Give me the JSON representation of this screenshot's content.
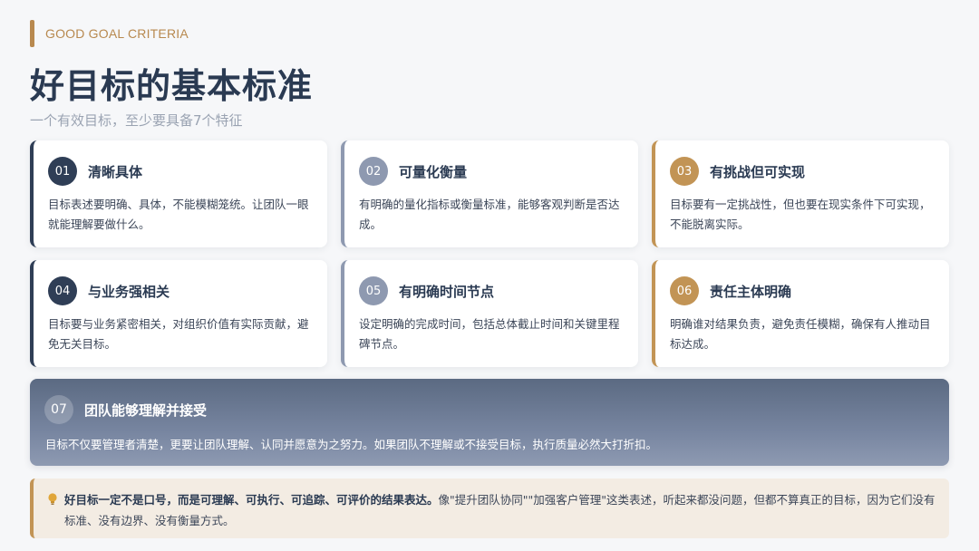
{
  "eyebrow": "GOOD GOAL CRITERIA",
  "title": "好目标的基本标准",
  "subtitle": "一个有效目标，至少要具备7个特征",
  "cards": [
    {
      "num": "01",
      "title": "清晰具体",
      "desc": "目标表述要明确、具体，不能模糊笼统。让团队一眼就能理解要做什么。",
      "accent": "#2f3e56"
    },
    {
      "num": "02",
      "title": "可量化衡量",
      "desc": "有明确的量化指标或衡量标准，能够客观判断是否达成。",
      "accent": "#8e99b0"
    },
    {
      "num": "03",
      "title": "有挑战但可实现",
      "desc": "目标要有一定挑战性，但也要在现实条件下可实现，不能脱离实际。",
      "accent": "#c29455"
    },
    {
      "num": "04",
      "title": "与业务强相关",
      "desc": "目标要与业务紧密相关，对组织价值有实际贡献，避免无关目标。",
      "accent": "#2f3e56"
    },
    {
      "num": "05",
      "title": "有明确时间节点",
      "desc": "设定明确的完成时间，包括总体截止时间和关键里程碑节点。",
      "accent": "#8e99b0"
    },
    {
      "num": "06",
      "title": "责任主体明确",
      "desc": "明确谁对结果负责，避免责任模糊，确保有人推动目标达成。",
      "accent": "#c29455"
    }
  ],
  "wide_card": {
    "num": "07",
    "title": "团队能够理解并接受",
    "desc": "目标不仅要管理者清楚，更要让团队理解、认同并愿意为之努力。如果团队不理解或不接受目标，执行质量必然大打折扣。"
  },
  "note": {
    "icon": "lightbulb-icon",
    "strong": "好目标一定不是口号，而是可理解、可执行、可追踪、可评价的结果表达。",
    "rest": "像\"提升团队协同\"\"加强客户管理\"这类表述，听起来都没问题，但都不算真正的目标，因为它们没有标准、没有边界、没有衡量方式。"
  }
}
